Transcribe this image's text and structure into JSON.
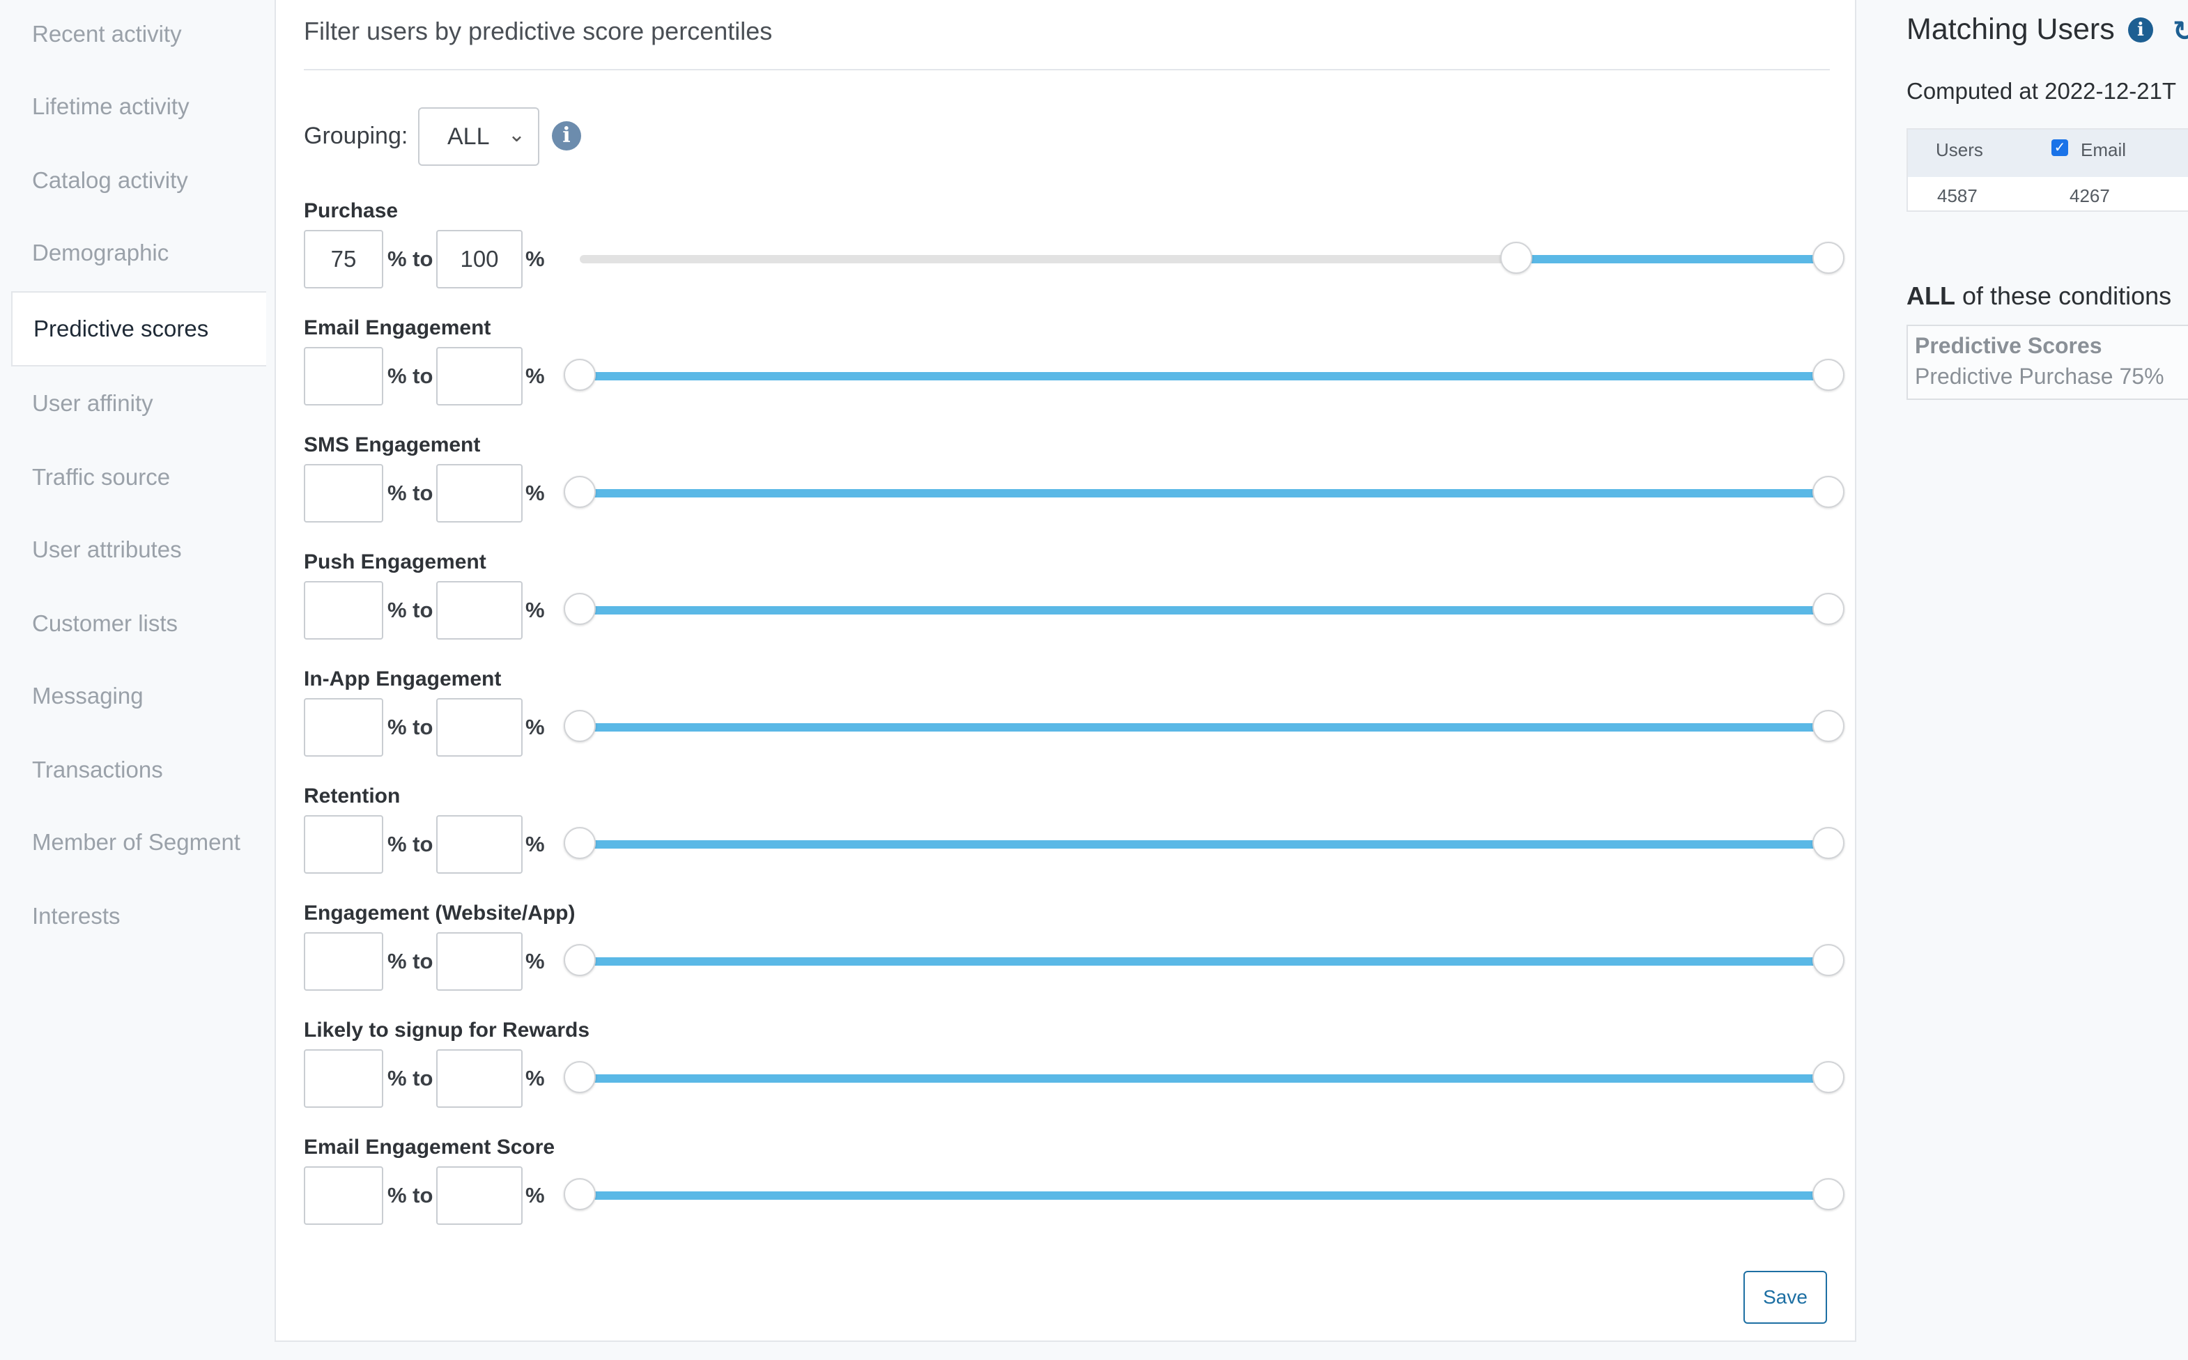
{
  "sidebar": {
    "items": [
      {
        "label": "Recent activity",
        "active": false
      },
      {
        "label": "Lifetime activity",
        "active": false
      },
      {
        "label": "Catalog activity",
        "active": false
      },
      {
        "label": "Demographic",
        "active": false
      },
      {
        "label": "Predictive scores",
        "active": true
      },
      {
        "label": "User affinity",
        "active": false
      },
      {
        "label": "Traffic source",
        "active": false
      },
      {
        "label": "User attributes",
        "active": false
      },
      {
        "label": "Customer lists",
        "active": false
      },
      {
        "label": "Messaging",
        "active": false
      },
      {
        "label": "Transactions",
        "active": false
      },
      {
        "label": "Member of Segment",
        "active": false
      },
      {
        "label": "Interests",
        "active": false
      }
    ]
  },
  "main": {
    "title": "Filter users by predictive score percentiles",
    "grouping": {
      "label": "Grouping:",
      "value": "ALL",
      "info_icon": "info-icon"
    },
    "to_label": "% to",
    "pct_label": "%",
    "rows": [
      {
        "label": "Purchase",
        "from": "75",
        "to": "100",
        "range": [
          75,
          100
        ]
      },
      {
        "label": "Email Engagement",
        "from": "",
        "to": "",
        "range": [
          0,
          100
        ]
      },
      {
        "label": "SMS Engagement",
        "from": "",
        "to": "",
        "range": [
          0,
          100
        ]
      },
      {
        "label": "Push Engagement",
        "from": "",
        "to": "",
        "range": [
          0,
          100
        ]
      },
      {
        "label": "In-App Engagement",
        "from": "",
        "to": "",
        "range": [
          0,
          100
        ]
      },
      {
        "label": "Retention",
        "from": "",
        "to": "",
        "range": [
          0,
          100
        ]
      },
      {
        "label": "Engagement (Website/App)",
        "from": "",
        "to": "",
        "range": [
          0,
          100
        ]
      },
      {
        "label": "Likely to signup for Rewards",
        "from": "",
        "to": "",
        "range": [
          0,
          100
        ]
      },
      {
        "label": "Email Engagement Score",
        "from": "",
        "to": "",
        "range": [
          0,
          100
        ]
      }
    ],
    "save_label": "Save"
  },
  "right": {
    "title": "Matching Users",
    "title_icons": [
      "info-icon",
      "refresh-icon"
    ],
    "computed": "Computed at 2022-12-21T",
    "table": {
      "headers": [
        "Users",
        "Email"
      ],
      "email_checked": true,
      "values": [
        "4587",
        "4267"
      ]
    },
    "conditions": {
      "all_label": "ALL",
      "suffix": " of these conditions",
      "category": "Predictive Scores",
      "detail": "Predictive Purchase 75%"
    }
  },
  "colors": {
    "accent": "#5ab8e6",
    "track": "#e2e2e2",
    "button": "#1d6fa3",
    "info": "#6c8cad"
  }
}
